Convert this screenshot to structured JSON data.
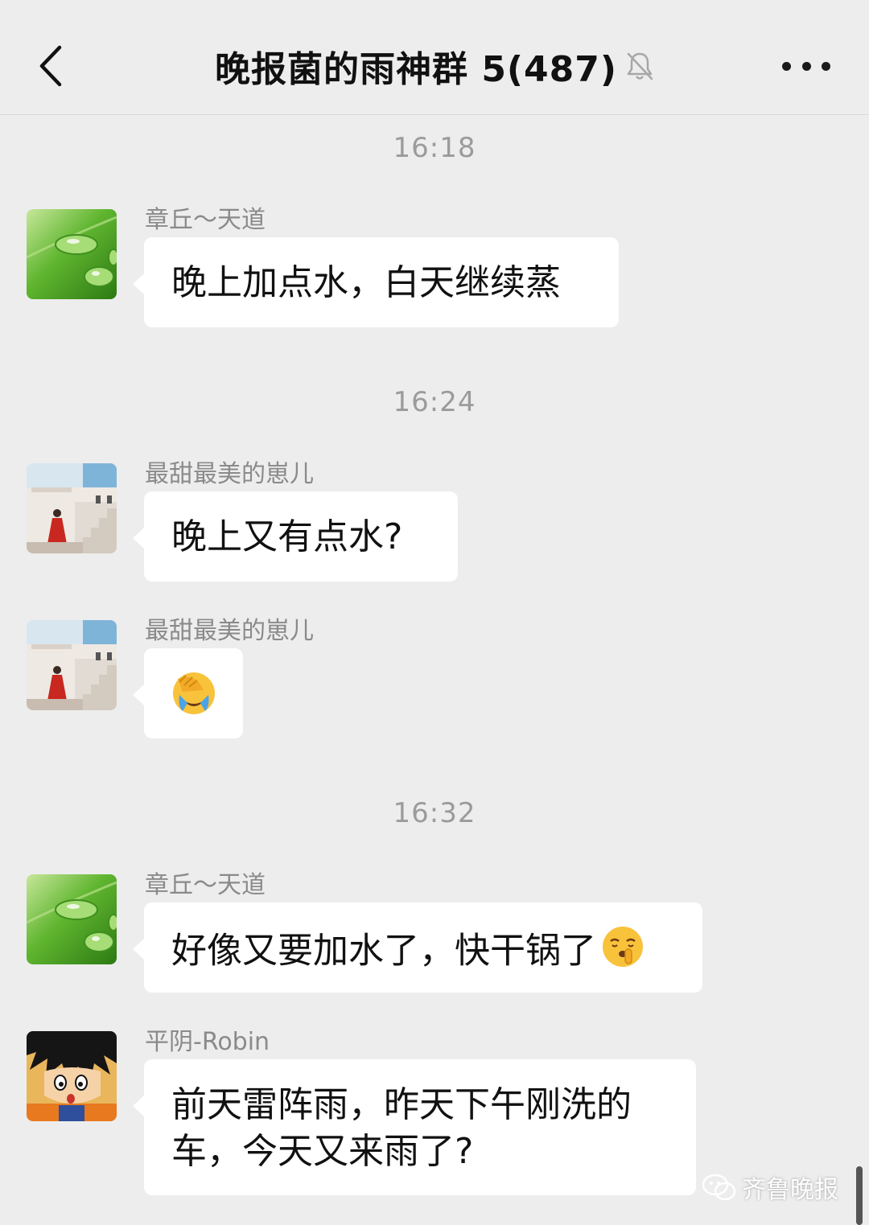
{
  "header": {
    "title": "晚报菌的雨神群 5(487)",
    "back_icon": "chevron-left-icon",
    "mute_icon": "bell-off-icon",
    "more_icon": "more-dots-icon"
  },
  "timestamps": [
    "16:18",
    "16:24",
    "16:32"
  ],
  "messages": [
    {
      "sender": "章丘～天道",
      "text": "晚上加点水，白天继续蒸",
      "avatar": "green-leaf-dewdrop"
    },
    {
      "sender": "最甜最美的崽儿",
      "text": "晚上又有点水?",
      "avatar": "woman-red-dress-stairs"
    },
    {
      "sender": "最甜最美的崽儿",
      "text": "",
      "emoji": "facepalm-crying-emoji",
      "avatar": "woman-red-dress-stairs"
    },
    {
      "sender": "章丘～天道",
      "text": "好像又要加水了，快干锅了",
      "emoji": "shushing-face-emoji",
      "avatar": "green-leaf-dewdrop"
    },
    {
      "sender": "平阴-Robin",
      "text_line1": "前天雷阵雨，昨天下午刚洗的",
      "text_line2": "车，今天又来雨了?",
      "avatar": "cartoon-boy"
    }
  ],
  "watermark": {
    "text": "齐鲁晚报",
    "icon": "wechat-logo-icon"
  },
  "colors": {
    "background": "#ededed",
    "bubble": "#ffffff",
    "timestamp": "#9b9b9b",
    "sender": "#8a8a8a"
  }
}
